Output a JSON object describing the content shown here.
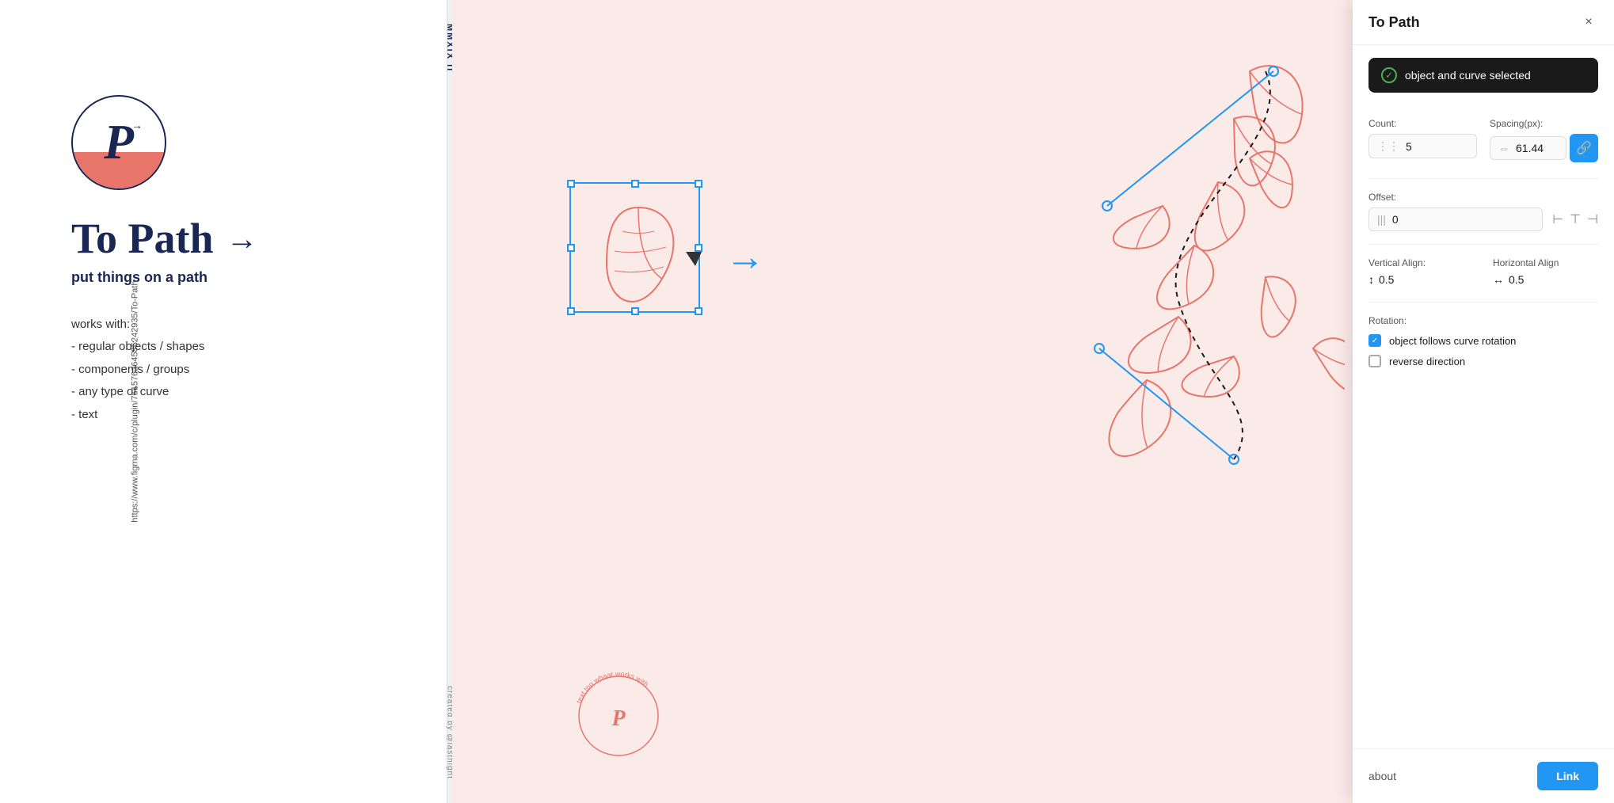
{
  "leftPanel": {
    "url": "https://www.figma.com/c/plugin/751576264585242935/To-Path",
    "logoLetter": "P",
    "dividerTop": "MMXIX II",
    "dividerBottom": "created by @lastnight",
    "mainTitle": "To Path",
    "titleArrow": "→",
    "subtitle": "put things on a path",
    "worksTitle": "works with:",
    "worksList": [
      "- regular objects / shapes",
      "- components / groups",
      "- any type of curve",
      "- text"
    ]
  },
  "pluginPanel": {
    "title": "To Path",
    "closeButton": "×",
    "statusText": "object and curve selected",
    "count": {
      "label": "Count:",
      "value": "5"
    },
    "spacing": {
      "label": "Spacing(px):",
      "value": "61.44"
    },
    "offset": {
      "label": "Offset:",
      "value": "0"
    },
    "verticalAlign": {
      "label": "Vertical Align:",
      "value": "0.5"
    },
    "horizontalAlign": {
      "label": "Horizontal Align",
      "value": "0.5"
    },
    "rotation": {
      "label": "Rotation:",
      "checkbox1": "object follows curve rotation",
      "checkbox2": "reverse direction"
    },
    "about": "about",
    "linkButton": "Link"
  }
}
